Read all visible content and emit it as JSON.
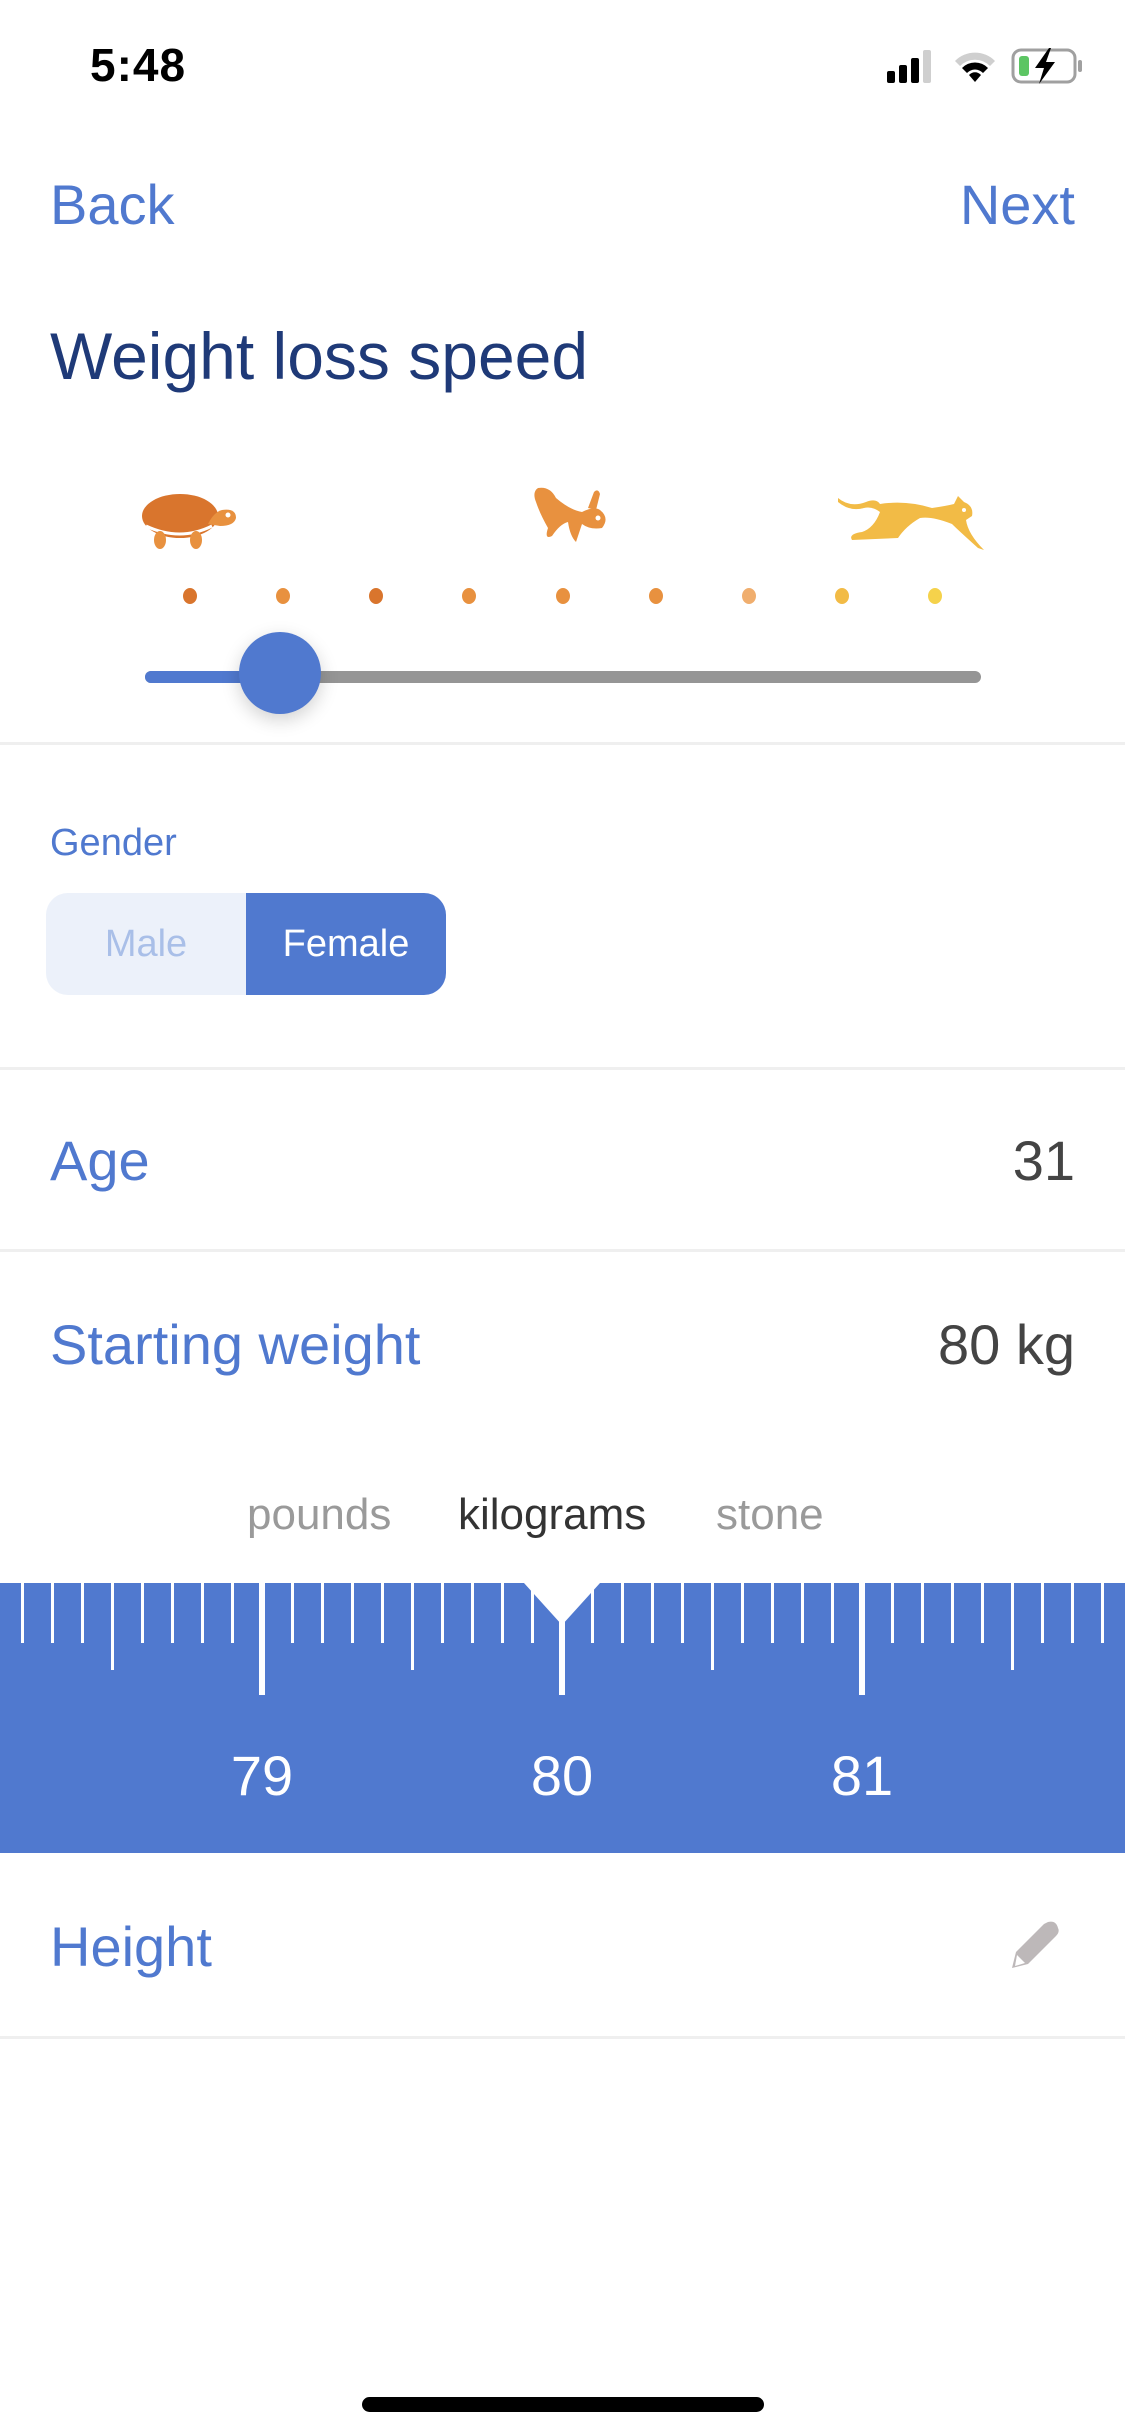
{
  "status_bar": {
    "time": "5:48",
    "icons": [
      "cellular-signal-icon",
      "wifi-icon",
      "battery-charging-icon"
    ]
  },
  "nav": {
    "back_label": "Back",
    "next_label": "Next"
  },
  "page_title": "Weight loss speed",
  "speed_slider": {
    "icons": [
      "turtle-icon",
      "rabbit-icon",
      "cheetah-icon"
    ],
    "steps": 9,
    "selected_index": 1,
    "dot_colors": [
      "#d9752d",
      "#e8913f",
      "#d9752d",
      "#e8913f",
      "#e8913f",
      "#e8913f",
      "#f0ae6e",
      "#f2bb46",
      "#f5d24b"
    ],
    "accent_color": "#5079cf"
  },
  "gender": {
    "label": "Gender",
    "options": [
      "Male",
      "Female"
    ],
    "selected": "Female"
  },
  "age": {
    "label": "Age",
    "value": "31"
  },
  "starting_weight": {
    "label": "Starting weight",
    "value": "80 kg",
    "units": [
      "pounds",
      "kilograms",
      "stone"
    ],
    "selected_unit": "kilograms",
    "ruler": {
      "value": 80,
      "labels": [
        "79",
        "80",
        "81"
      ],
      "minor_step": 0.1
    }
  },
  "height": {
    "label": "Height",
    "edit_icon": "pencil-icon"
  }
}
